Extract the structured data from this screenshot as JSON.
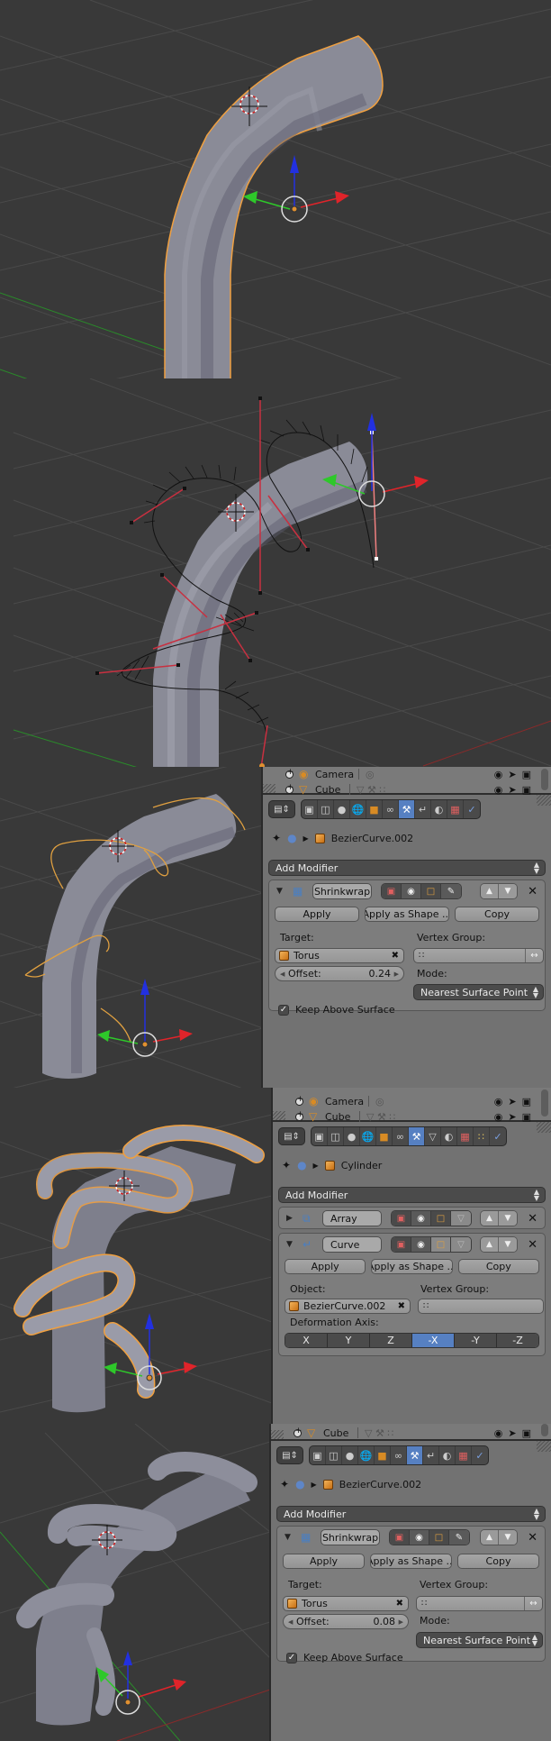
{
  "viewports": [
    {
      "name": "viewport-original-bent-tube",
      "desc": "Bent cylinder selected (orange outline) with 3D cursor and transform manipulator"
    },
    {
      "name": "viewport-bezier-curve-edit",
      "desc": "Bezier curve in edit mode spiraling around the tube with red handles"
    },
    {
      "name": "viewport-shrinkwrapped-curve",
      "desc": "Orange bezier curve wrapped around the tube"
    },
    {
      "name": "viewport-curve-deformed-cylinder",
      "desc": "Cylinder deformed along curve, wrapping around tube"
    },
    {
      "name": "viewport-final-wrapped",
      "desc": "Final wrapped tube with reduced offset"
    }
  ],
  "outliner": {
    "rows": [
      {
        "name": "Camera",
        "icon": "camera-icon",
        "data_icon": "camera-data-icon"
      },
      {
        "name": "Cube",
        "icon": "mesh-icon",
        "data_icon": "mesh-data-icon"
      }
    ],
    "right_icons": [
      "eye-icon",
      "cursor-icon",
      "render-icon"
    ]
  },
  "tabs_panel1": [
    "render",
    "render-layers",
    "scene",
    "world",
    "object",
    "constraints",
    "modifiers",
    "data-curve",
    "material",
    "texture",
    "physics"
  ],
  "tabs_panel2": [
    "render",
    "render-layers",
    "scene",
    "world",
    "object",
    "constraints",
    "modifiers",
    "data-mesh",
    "material",
    "texture",
    "particles",
    "physics"
  ],
  "panels": [
    {
      "object_name": "BezierCurve.002",
      "add_modifier": "Add Modifier",
      "modifier": {
        "type": "Shrinkwrap",
        "name": "Shrinkwrap",
        "apply": "Apply",
        "apply_shape": "Apply as Shape ...",
        "copy": "Copy",
        "target_label": "Target:",
        "target_value": "Torus",
        "vertex_group_label": "Vertex Group:",
        "vertex_group_value": "",
        "offset_label": "Offset:",
        "offset_value": "0.24",
        "mode_label": "Mode:",
        "mode_value": "Nearest Surface Point",
        "keep_above_label": "Keep Above Surface",
        "keep_above_checked": true
      }
    },
    {
      "object_name": "Cylinder",
      "add_modifier": "Add Modifier",
      "modifiers": [
        {
          "type": "Array",
          "name": "Array",
          "collapsed": true
        },
        {
          "type": "Curve",
          "name": "Curve",
          "collapsed": false,
          "apply": "Apply",
          "apply_shape": "Apply as Shape ...",
          "copy": "Copy",
          "object_label": "Object:",
          "object_value": "BezierCurve.002",
          "vertex_group_label": "Vertex Group:",
          "vertex_group_value": "",
          "deformation_axis_label": "Deformation Axis:",
          "axes": [
            "X",
            "Y",
            "Z",
            "-X",
            "-Y",
            "-Z"
          ],
          "selected_axis": "-X"
        }
      ]
    },
    {
      "object_name": "BezierCurve.002",
      "add_modifier": "Add Modifier",
      "modifier": {
        "type": "Shrinkwrap",
        "name": "Shrinkwrap",
        "apply": "Apply",
        "apply_shape": "Apply as Shape ...",
        "copy": "Copy",
        "target_label": "Target:",
        "target_value": "Torus",
        "vertex_group_label": "Vertex Group:",
        "vertex_group_value": "",
        "offset_label": "Offset:",
        "offset_value": "0.08",
        "mode_label": "Mode:",
        "mode_value": "Nearest Surface Point",
        "keep_above_label": "Keep Above Surface",
        "keep_above_checked": true
      }
    }
  ],
  "colors": {
    "viewport_bg": "#393939",
    "selection_outline": "#f0a040",
    "active_tab": "#5680c2",
    "axis_x": "#e0242a",
    "axis_y": "#2ec82a",
    "axis_z": "#2230e0"
  }
}
